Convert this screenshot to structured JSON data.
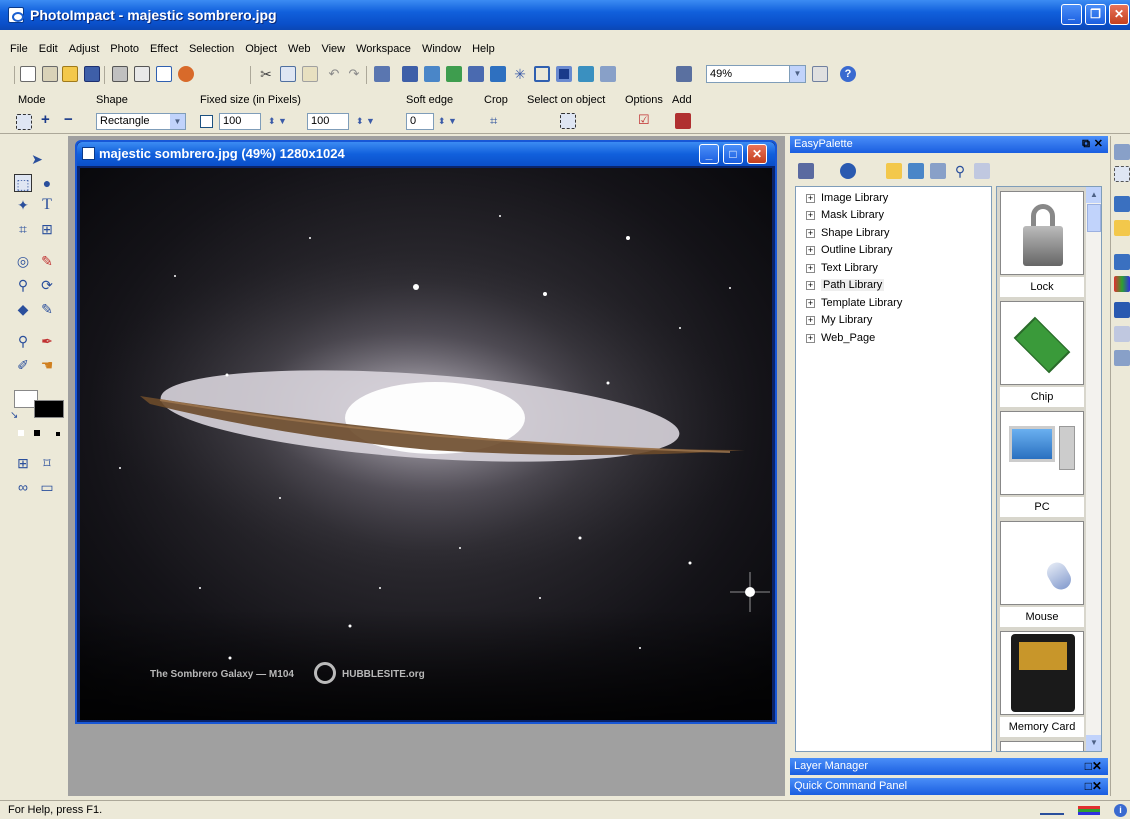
{
  "app": {
    "title": "PhotoImpact - majestic sombrero.jpg"
  },
  "menu": [
    "File",
    "Edit",
    "Adjust",
    "Photo",
    "Effect",
    "Selection",
    "Object",
    "Web",
    "View",
    "Workspace",
    "Window",
    "Help"
  ],
  "zoom": "49%",
  "attributes": {
    "mode_label": "Mode",
    "shape_label": "Shape",
    "shape_value": "Rectangle",
    "fixed_label": "Fixed size (in Pixels)",
    "width_value": "100",
    "height_value": "100",
    "soft_edge_label": "Soft edge",
    "soft_edge_value": "0",
    "crop_label": "Crop",
    "select_on_object_label": "Select on object",
    "options_label": "Options",
    "add_label": "Add"
  },
  "document": {
    "title": "majestic sombrero.jpg (49%) 1280x1024",
    "caption": "The Sombrero Galaxy — M104",
    "watermark_brand": "HUBBLESITE.org"
  },
  "easypalette": {
    "title": "EasyPalette",
    "tree": [
      "Image Library",
      "Mask Library",
      "Shape Library",
      "Outline Library",
      "Text Library",
      "Path Library",
      "Template Library",
      "My Library",
      "Web_Page"
    ],
    "thumbnails": [
      "Lock",
      "Chip",
      "PC",
      "Mouse",
      "Memory Card"
    ]
  },
  "panels": {
    "layer_manager": "Layer Manager",
    "quick_command": "Quick Command Panel"
  },
  "status": "For Help, press F1.",
  "colors": {
    "titlebar": "#0a4fc9",
    "workarea": "#a0a0a0",
    "galaxy_core": "#f0eef2",
    "dust_lane": "#6b4a2a"
  }
}
